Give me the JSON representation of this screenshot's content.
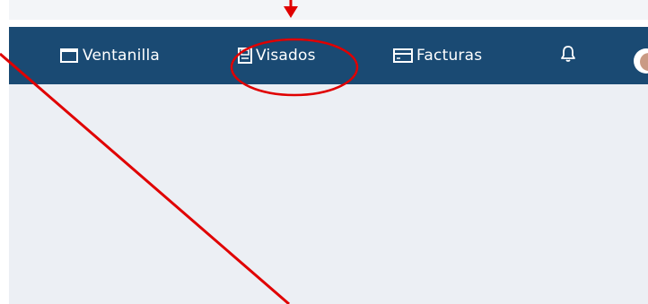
{
  "navbar": {
    "items": [
      {
        "label": "Ventanilla",
        "icon": "window-icon"
      },
      {
        "label": "Visados",
        "icon": "save-document-icon"
      },
      {
        "label": "Facturas",
        "icon": "credit-card-icon"
      }
    ],
    "notification_icon": "bell-icon",
    "avatar_icon": "user-avatar"
  },
  "colors": {
    "navbar_bg": "#1a4a73",
    "content_bg": "#eceff4",
    "annotation": "#e00000"
  },
  "annotation": {
    "highlighted_item": "Visados",
    "marks": [
      "down-arrow",
      "highlight-ellipse",
      "diagonal-line"
    ]
  }
}
